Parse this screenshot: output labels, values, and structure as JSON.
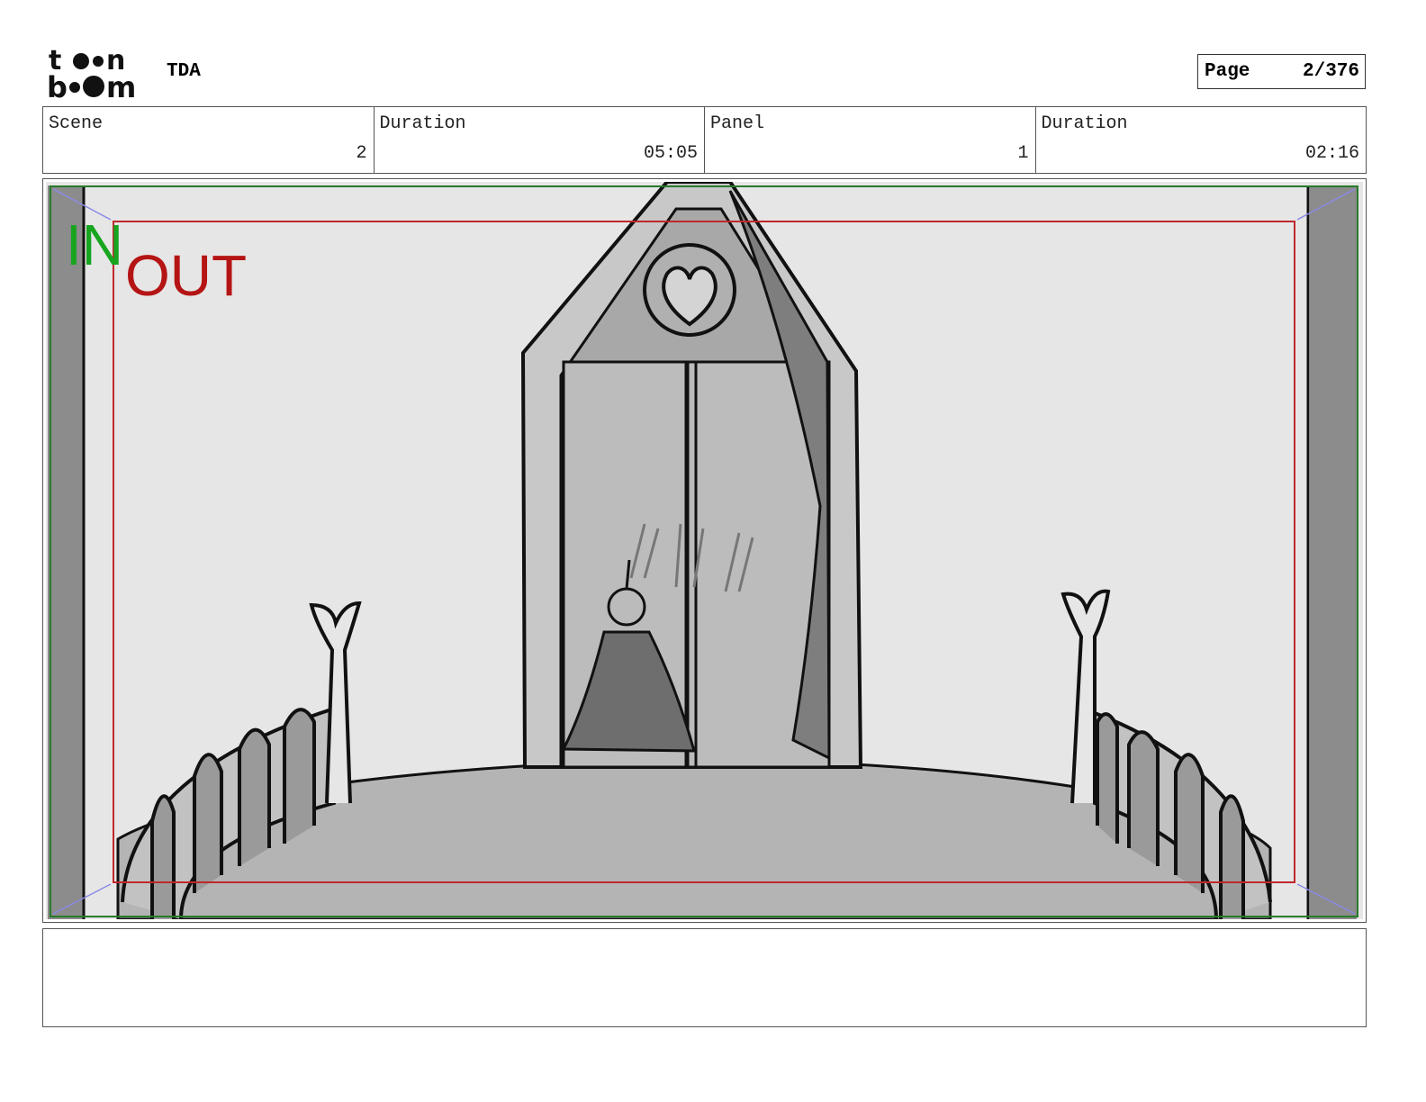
{
  "header": {
    "logo_text": "toon boom",
    "project": "TDA",
    "page_label": "Page",
    "page_value": "2/376"
  },
  "info": {
    "scene_label": "Scene",
    "scene_value": "2",
    "scene_duration_label": "Duration",
    "scene_duration_value": "05:05",
    "panel_label": "Panel",
    "panel_value": "1",
    "panel_duration_label": "Duration",
    "panel_duration_value": "02:16"
  },
  "panel": {
    "in_label": "IN",
    "out_label": "OUT",
    "colors": {
      "in": "#17a51f",
      "out": "#b51414",
      "safe_frame": "#2a7a2a",
      "camera_frame": "#c0272d",
      "background": "#e6e6e6",
      "side_bars": "#8c8c8c"
    }
  },
  "notes": {
    "text": ""
  }
}
